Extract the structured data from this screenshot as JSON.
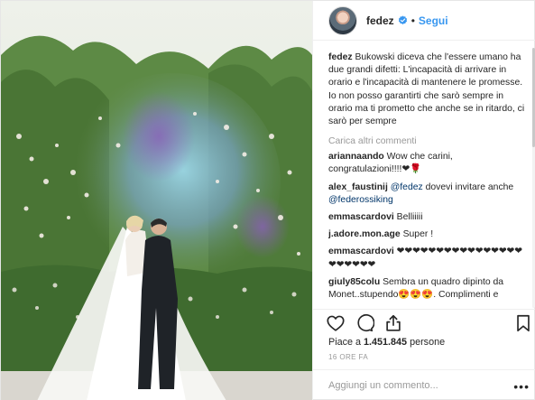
{
  "header": {
    "username": "fedez",
    "separator": "•",
    "follow_label": "Segui"
  },
  "caption": {
    "username": "fedez",
    "text": "Bukowski diceva che l'essere umano ha due grandi difetti: L'incapacità di arrivare in orario e l'incapacità di mantenere le promesse. Io non posso garantirti che sarò sempre in orario ma ti prometto che anche se in ritardo, ci sarò per sempre"
  },
  "load_more_label": "Carica altri commenti",
  "comments": [
    {
      "username": "ariannaando",
      "text": "Wow che carini, congratulazioni!!!!❤🌹"
    },
    {
      "username": "alex_faustinij",
      "mention1": "@fedez",
      "text": "dovevi invitare anche",
      "mention2": "@federossiking"
    },
    {
      "username": "emmascardovi",
      "text": "Belliiiii"
    },
    {
      "username": "j.adore.mon.age",
      "text": "Super !"
    },
    {
      "username": "emmascardovi",
      "text": "❤❤❤❤❤❤❤❤❤❤❤❤❤❤❤❤❤❤❤❤❤❤"
    },
    {
      "username": "giuly85colu",
      "text": "Sembra un quadro dipinto da Monet..stupendo😍😍😍. Complimenti e"
    }
  ],
  "likes": {
    "prefix": "Piace a",
    "count": "1.451.845",
    "suffix": "persone"
  },
  "timestamp": "16 ORE FA",
  "add_comment": {
    "placeholder": "Aggiungi un commento...",
    "more_label": "•••"
  },
  "icons": [
    "heart-icon",
    "comment-icon",
    "share-icon",
    "bookmark-icon",
    "verified-icon"
  ],
  "colors": {
    "accent": "#3897f0",
    "verified": "#3897f0",
    "text": "#262626",
    "muted": "#999999",
    "border": "#efefef"
  }
}
